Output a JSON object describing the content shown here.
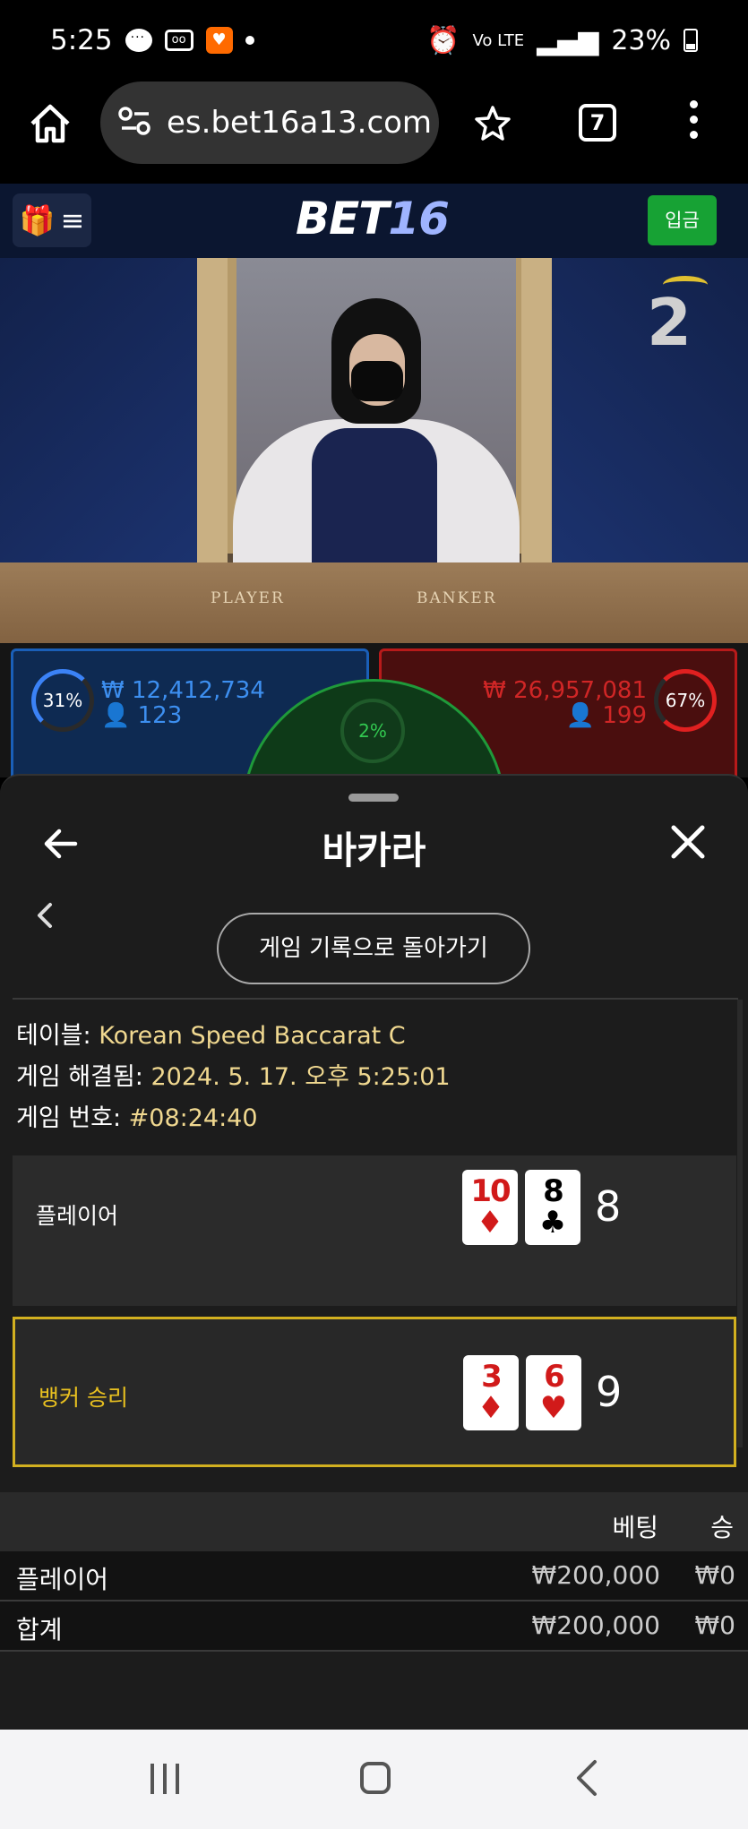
{
  "status_bar": {
    "time": "5:25",
    "app_icon_text": "♥",
    "signal_text": "Vo LTE",
    "lte": "LTE",
    "battery": "23%"
  },
  "browser": {
    "url": "es.bet16a13.com",
    "tab_count": "7"
  },
  "site": {
    "logo_main": "BET",
    "logo_num": "16",
    "deposit_label": "입금"
  },
  "video": {
    "player_label": "PLAYER",
    "banker_label": "BANKER",
    "countdown": "2"
  },
  "bets_panel": {
    "player_pct": "31%",
    "player_amount": "₩ 12,412,734",
    "player_count": "123",
    "banker_pct": "67%",
    "banker_amount": "₩ 26,957,081",
    "banker_count": "199",
    "tie_pct": "2%"
  },
  "modal": {
    "title": "바카라",
    "back_history_label": "게임 기록으로 돌아가기",
    "table_label": "테이블:",
    "table_value": "Korean Speed Baccarat C",
    "resolved_label": "게임 해결됨:",
    "resolved_value": "2024. 5. 17. 오후 5:25:01",
    "game_no_label": "게임 번호:",
    "game_no_value": "#08:24:40",
    "player_hand": {
      "label": "플레이어",
      "cards": [
        {
          "rank": "10",
          "suit": "♦",
          "color": "#d11a1a"
        },
        {
          "rank": "8",
          "suit": "♣",
          "color": "#000000"
        }
      ],
      "total": "8"
    },
    "banker_hand": {
      "label": "뱅커 승리",
      "cards": [
        {
          "rank": "3",
          "suit": "♦",
          "color": "#d11a1a"
        },
        {
          "rank": "6",
          "suit": "♥",
          "color": "#d11a1a"
        }
      ],
      "total": "9"
    },
    "bet_table": {
      "header_bet": "베팅",
      "header_win": "승",
      "rows": [
        {
          "name": "플레이어",
          "bet": "₩200,000",
          "win": "₩0"
        },
        {
          "name": "합계",
          "bet": "₩200,000",
          "win": "₩0"
        }
      ]
    }
  },
  "colors": {
    "accent_gold": "#d2b020",
    "deposit_green": "#17a234",
    "player_blue": "#1a5fb8",
    "banker_red": "#b81a1a"
  }
}
